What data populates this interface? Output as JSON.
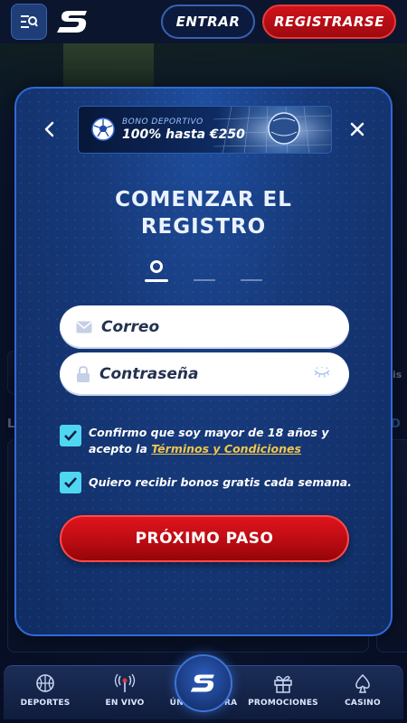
{
  "header": {
    "login_label": "ENTRAR",
    "register_label": "REGISTRARSE"
  },
  "background": {
    "left_letter": "L",
    "right_letter": "D",
    "side_text": "is"
  },
  "modal": {
    "promo": {
      "subtitle": "BONO DEPORTIVO",
      "headline": "100% hasta €250"
    },
    "title_line1": "COMENZAR EL",
    "title_line2": "REGISTRO",
    "email_placeholder": "Correo",
    "password_placeholder": "Contraseña",
    "age_consent_prefix": "Confirmo que soy mayor de 18 años y acepto la ",
    "terms_link": "Términos y Condiciones",
    "bonus_consent": "Quiero recibir bonos gratis cada semana.",
    "next_button": "PRÓXIMO PASO",
    "checkbox_color": "#4fd6f0",
    "accent_red": "#d0121a"
  },
  "bottom_nav": {
    "items": [
      {
        "label": "DEPORTES",
        "icon": "basketball-icon"
      },
      {
        "label": "EN VIVO",
        "icon": "live-broadcast-icon"
      },
      {
        "label": "ÚNETE AHORA",
        "icon": "logo-icon"
      },
      {
        "label": "PROMOCIONES",
        "icon": "gift-icon"
      },
      {
        "label": "CASINO",
        "icon": "spade-icon"
      }
    ]
  }
}
